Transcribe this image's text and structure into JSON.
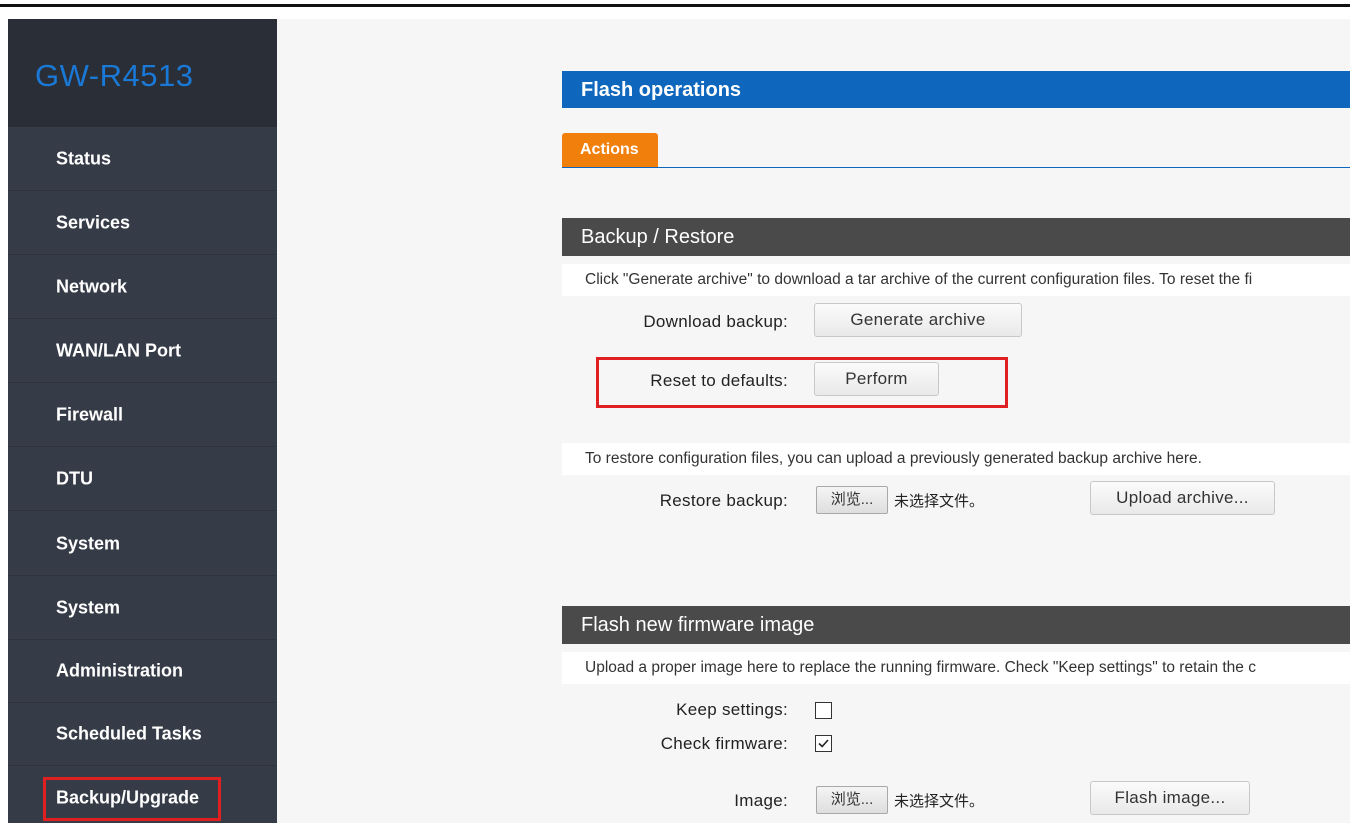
{
  "brand": "GW-R4513",
  "sidebar": {
    "items": [
      {
        "label": "Status"
      },
      {
        "label": "Services"
      },
      {
        "label": "Network"
      },
      {
        "label": "WAN/LAN Port"
      },
      {
        "label": "Firewall"
      },
      {
        "label": "DTU"
      },
      {
        "label": "System"
      },
      {
        "label": "System"
      },
      {
        "label": "Administration"
      },
      {
        "label": "Scheduled Tasks"
      },
      {
        "label": "Backup/Upgrade",
        "highlighted": true
      }
    ]
  },
  "panel": {
    "title": "Flash operations",
    "tabs": [
      {
        "label": "Actions",
        "active": true
      }
    ]
  },
  "backup": {
    "title": "Backup / Restore",
    "description": "Click \"Generate archive\" to download a tar archive of the current configuration files. To reset the fi",
    "download_label": "Download backup:",
    "generate_button": "Generate archive",
    "reset_label": "Reset to defaults:",
    "perform_button": "Perform",
    "restore_description": "To restore configuration files, you can upload a previously generated backup archive here.",
    "restore_label": "Restore backup:",
    "browse_button": "浏览...",
    "no_file": "未选择文件。",
    "upload_button": "Upload archive..."
  },
  "firmware": {
    "title": "Flash new firmware image",
    "description": "Upload a proper image here to replace the running firmware. Check \"Keep settings\" to retain the c",
    "keep_settings_label": "Keep settings:",
    "keep_settings_checked": false,
    "check_firmware_label": "Check firmware:",
    "check_firmware_checked": true,
    "image_label": "Image:",
    "browse_button": "浏览...",
    "no_file": "未选择文件。",
    "flash_button": "Flash image..."
  },
  "colors": {
    "accent_blue": "#0e66bd",
    "tab_orange": "#f07f0c",
    "sidebar_bg": "#363c47",
    "brand_bg": "#2a2e36",
    "brand_text": "#1a78d6",
    "highlight_red": "#e02020",
    "section_header": "#4a4a4a"
  }
}
